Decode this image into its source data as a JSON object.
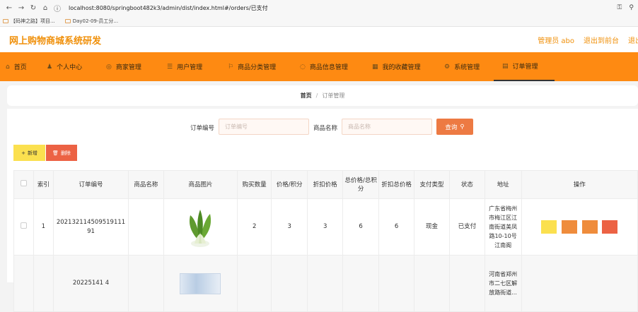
{
  "browser": {
    "url": "localhost:8080/springboot482k3/admin/dist/index.html#/orders/已支付"
  },
  "bookmarks": [
    {
      "label": "【码神之路】项目..."
    },
    {
      "label": "Day02-09-员工分..."
    }
  ],
  "header": {
    "title": "网上购物商城系统研发",
    "admin_label": "管理员 abo",
    "to_front": "退出到前台",
    "logout": "退出"
  },
  "nav": [
    {
      "label": "首页",
      "icon": "home-icon"
    },
    {
      "label": "个人中心",
      "icon": "user-icon"
    },
    {
      "label": "商家管理",
      "icon": "store-icon"
    },
    {
      "label": "用户管理",
      "icon": "users-icon"
    },
    {
      "label": "商品分类管理",
      "icon": "category-icon"
    },
    {
      "label": "商品信息管理",
      "icon": "goods-icon"
    },
    {
      "label": "我的收藏管理",
      "icon": "star-icon"
    },
    {
      "label": "系统管理",
      "icon": "gear-icon"
    },
    {
      "label": "订单管理",
      "icon": "order-icon"
    }
  ],
  "breadcrumb": {
    "home": "首页",
    "sep": "/",
    "current": "订单管理"
  },
  "search": {
    "order_no_label": "订单编号",
    "order_no_placeholder": "订单编号",
    "goods_name_label": "商品名称",
    "goods_name_placeholder": "商品名称",
    "query_label": "查询"
  },
  "actions": {
    "add_label": "新增",
    "delete_label": "删除"
  },
  "table": {
    "headers": [
      "索引",
      "订单编号",
      "商品名称",
      "商品图片",
      "购买数量",
      "价格/积分",
      "折扣价格",
      "总价格/总积分",
      "折扣总价格",
      "支付类型",
      "状态",
      "地址",
      "操作"
    ],
    "rows": [
      {
        "index": "1",
        "order_no": "202132114509519111 91",
        "goods_name": "",
        "image": "bok-choy",
        "quantity": "2",
        "price": "3",
        "discount_price": "3",
        "total": "6",
        "discount_total": "6",
        "pay_type": "现金",
        "status": "已支付",
        "address": "广东省梅州市梅江区江南街道美凤路10-10号江南阁"
      },
      {
        "index": "",
        "order_no": "20225141 4",
        "goods_name": "",
        "image": "book",
        "quantity": "",
        "price": "",
        "discount_price": "",
        "total": "",
        "discount_total": "",
        "pay_type": "",
        "status": "",
        "address": "河南省郑州市二七区解放路街道..."
      }
    ]
  },
  "colors": {
    "brand": "#f0900a",
    "navbar": "#fe8a12",
    "query": "#ed7a43",
    "add": "#fbe04f",
    "delete": "#ec6244"
  }
}
